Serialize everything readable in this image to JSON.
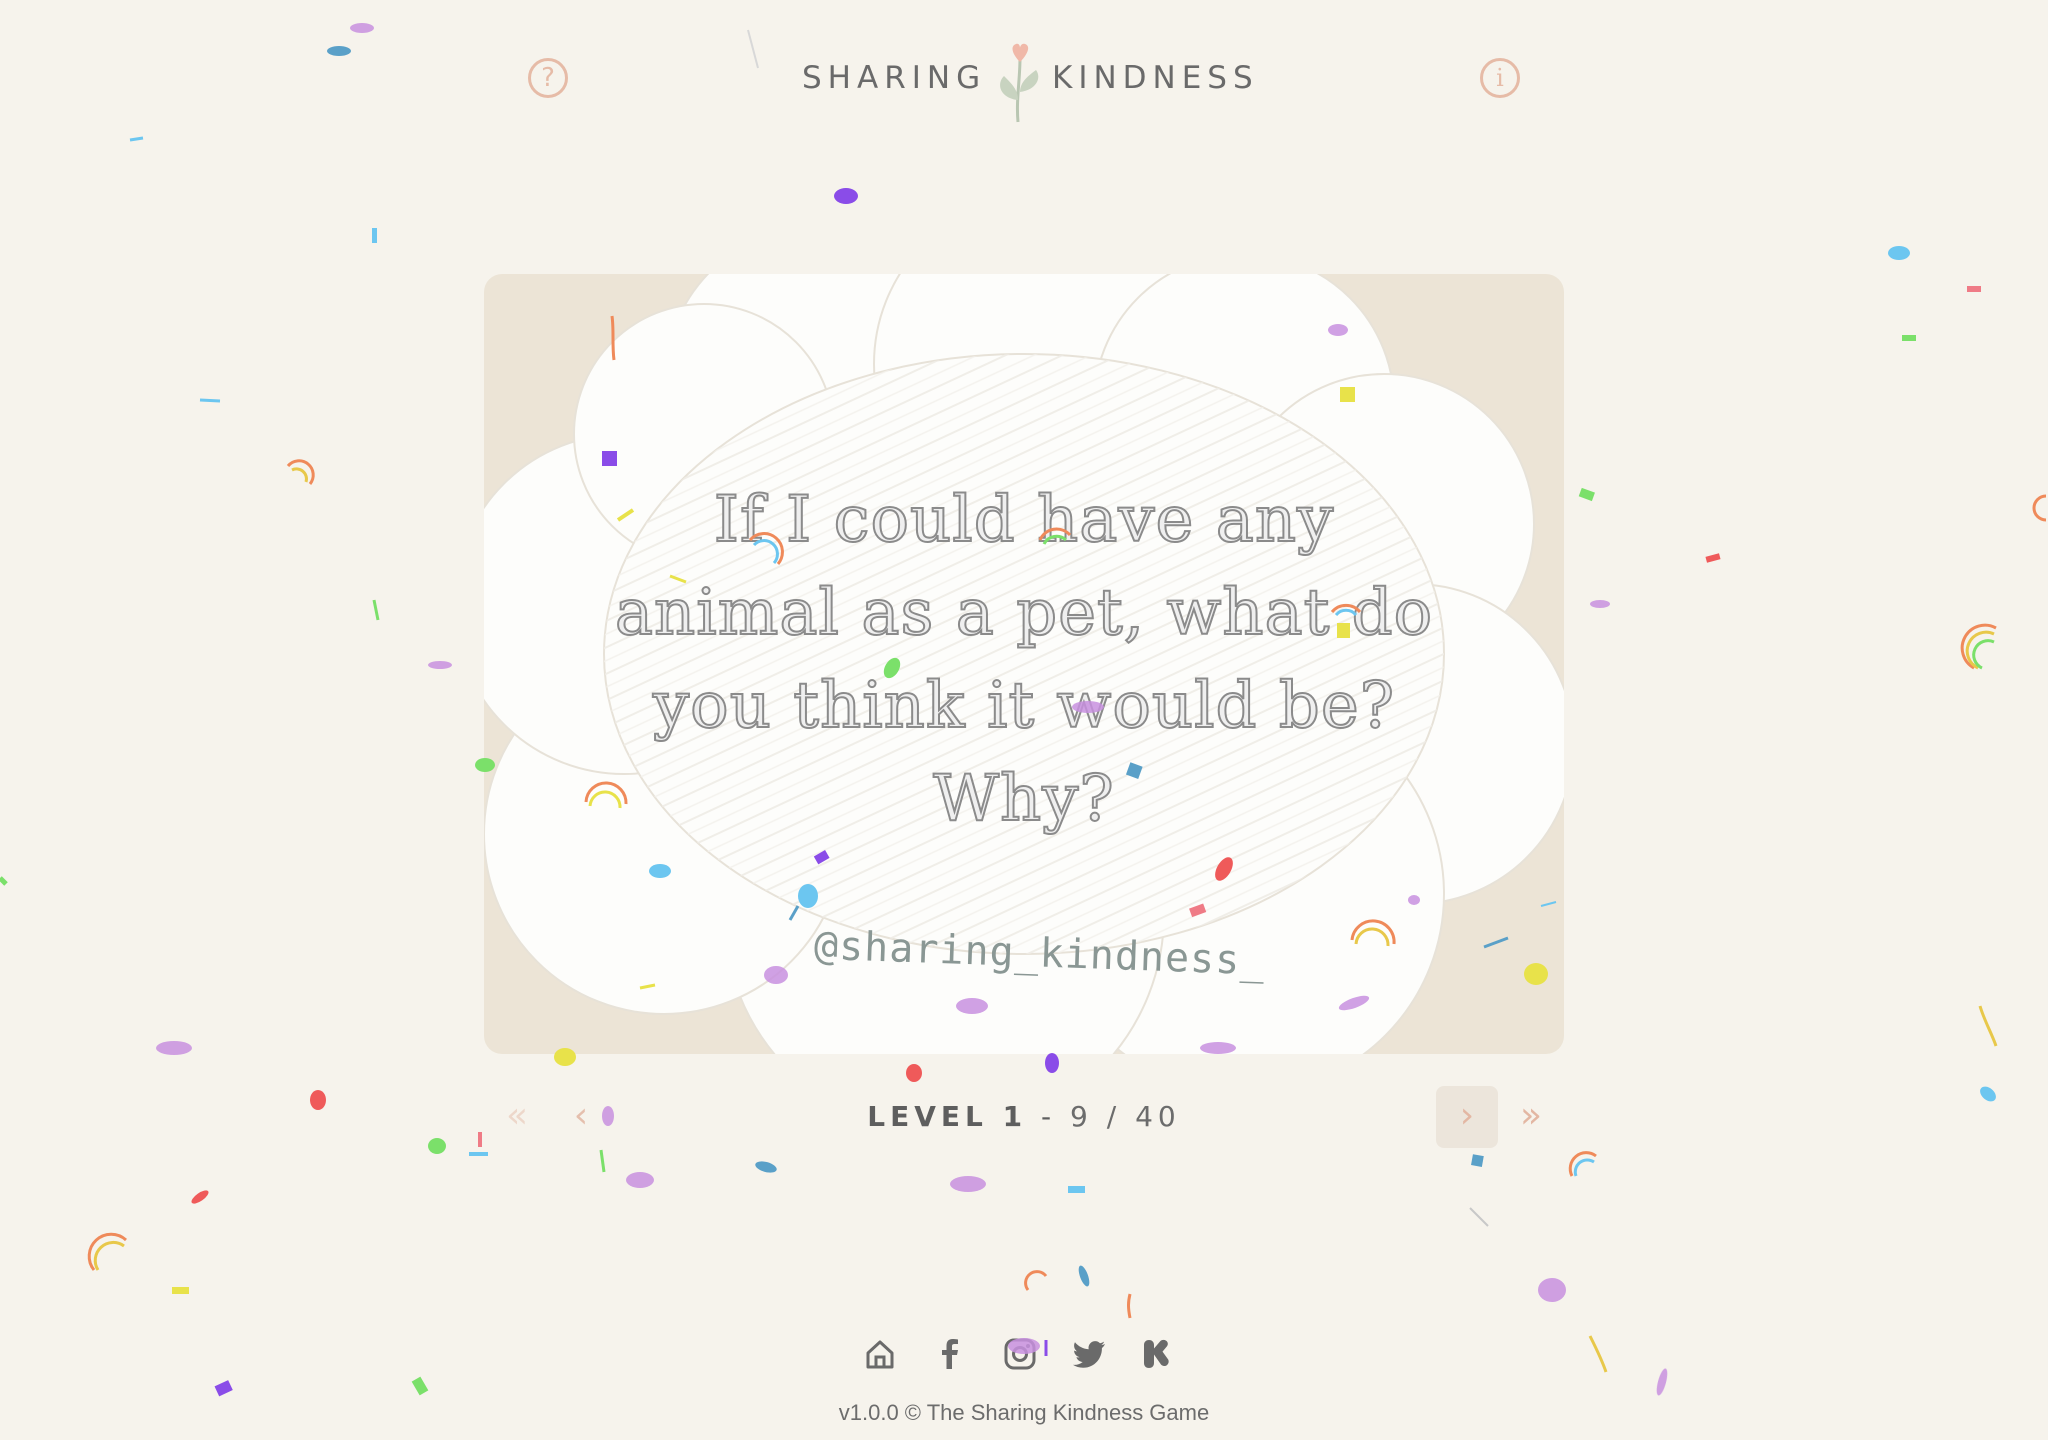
{
  "header": {
    "logo_left": "SHARING",
    "logo_right": "KINDNESS",
    "help_icon": "question-circle-icon",
    "info_icon": "info-circle-icon",
    "help_glyph": "?",
    "info_glyph": "i"
  },
  "card": {
    "question": "If I could have any animal as a pet, what do you think it would be? Why?",
    "handle": "@sharing_kindness_"
  },
  "navigation": {
    "first_glyph": "«",
    "prev_glyph": "‹",
    "next_glyph": "›",
    "last_glyph": "»",
    "level_label": "LEVEL 1",
    "separator": "-",
    "current": "9",
    "total": "40",
    "count_text": "9 / 40"
  },
  "footer": {
    "social_icons": [
      "home-icon",
      "facebook-icon",
      "instagram-icon",
      "twitter-icon",
      "kickstarter-icon"
    ],
    "copyright": "v1.0.0 © The Sharing Kindness Game"
  },
  "colors": {
    "background": "#f6f3ec",
    "accent": "#e6bba7",
    "text": "#5e5e5e"
  }
}
